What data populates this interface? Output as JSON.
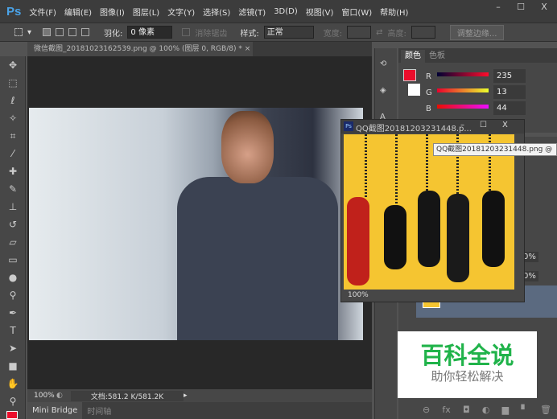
{
  "app": {
    "logo": "Ps"
  },
  "menu": [
    "文件(F)",
    "编辑(E)",
    "图像(I)",
    "图层(L)",
    "文字(Y)",
    "选择(S)",
    "滤镜(T)",
    "3D(D)",
    "视图(V)",
    "窗口(W)",
    "帮助(H)"
  ],
  "window_controls": {
    "minimize": "–",
    "maximize": "☐",
    "close": "X"
  },
  "options": {
    "feather_label": "羽化:",
    "feather_value": "0 像素",
    "antialias_label": "消除锯齿",
    "style_label": "样式:",
    "style_value": "正常",
    "width_label": "宽度:",
    "height_label": "高度:",
    "refine_button": "调整边缘..."
  },
  "document": {
    "tab_title": "微信截图_20181023162539.png @ 100% (图层 0, RGB/8) *",
    "tab_close": "×",
    "zoom": "100%",
    "doc_info": "文档:581.2 K/581.2K"
  },
  "bottom_tabs": [
    "Mini Bridge",
    "时间轴"
  ],
  "color_panel": {
    "tabs": [
      "颜色",
      "色板"
    ],
    "r_label": "R",
    "g_label": "G",
    "b_label": "B",
    "r": 235,
    "g": 13,
    "b": 44,
    "foreground": "#eb0d2c",
    "background": "#ffffff"
  },
  "float_window": {
    "title": "QQ截图20181203231448.p...",
    "zoom": "100%",
    "tooltip": "QQ截图20181203231448.png @"
  },
  "layers": {
    "opacity1": "0%",
    "opacity2": "0%"
  },
  "watermark": {
    "title": "百科全说",
    "subtitle": "助你轻松解决"
  }
}
